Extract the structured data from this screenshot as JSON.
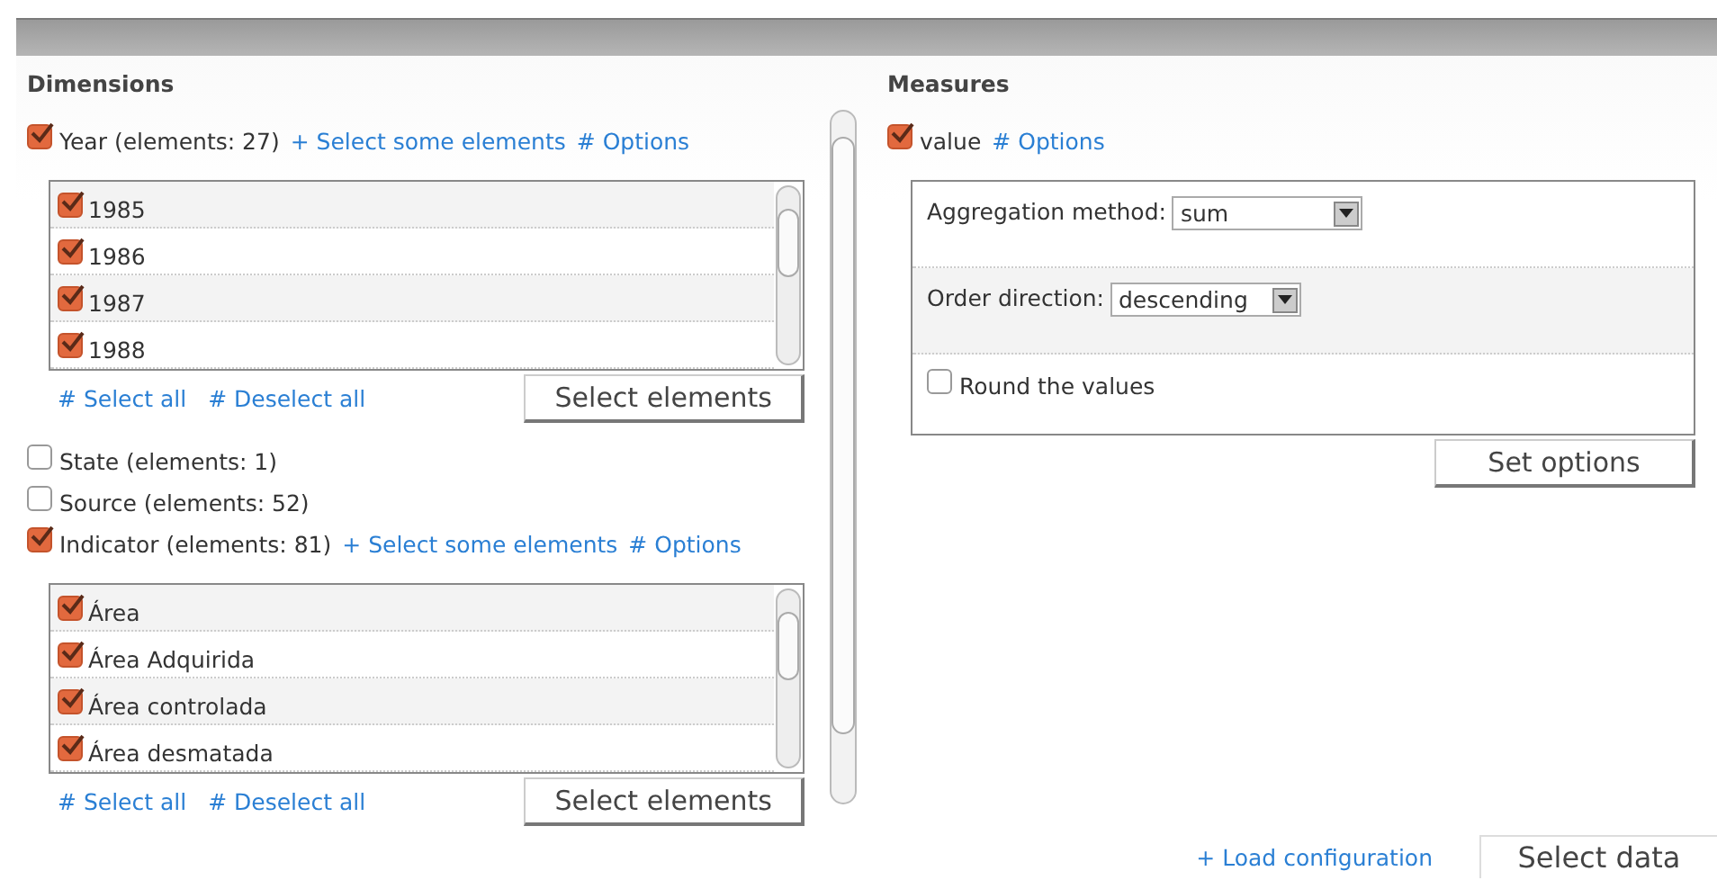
{
  "dimensions": {
    "title": "Dimensions",
    "items": [
      {
        "label": "Year (elements: 27)",
        "checked": true,
        "links": [
          "+ Select some elements",
          "# Options"
        ],
        "elements": {
          "items": [
            {
              "label": "1985",
              "checked": true
            },
            {
              "label": "1986",
              "checked": true
            },
            {
              "label": "1987",
              "checked": true
            },
            {
              "label": "1988",
              "checked": true
            }
          ],
          "select_all": "# Select all",
          "deselect_all": "# Deselect all",
          "button": "Select elements"
        }
      },
      {
        "label": "State (elements: 1)",
        "checked": false
      },
      {
        "label": "Source (elements: 52)",
        "checked": false
      },
      {
        "label": "Indicator (elements: 81)",
        "checked": true,
        "links": [
          "+ Select some elements",
          "# Options"
        ],
        "elements": {
          "items": [
            {
              "label": "Área",
              "checked": true
            },
            {
              "label": "Área Adquirida",
              "checked": true
            },
            {
              "label": "Área controlada",
              "checked": true
            },
            {
              "label": "Área desmatada",
              "checked": true
            }
          ],
          "select_all": "# Select all",
          "deselect_all": "# Deselect all",
          "button": "Select elements"
        }
      }
    ]
  },
  "measures": {
    "title": "Measures",
    "items": [
      {
        "label": "value",
        "checked": true,
        "link": "# Options",
        "options": {
          "fields": [
            {
              "kind": "select",
              "label": "Aggregation method:",
              "value": "sum"
            },
            {
              "kind": "select",
              "label": "Order direction:",
              "value": "descending"
            },
            {
              "kind": "checkbox",
              "label": "Round the values",
              "checked": false
            }
          ],
          "button": "Set options"
        }
      }
    ]
  },
  "footer": {
    "link": "+ Load configuration",
    "button": "Select data"
  }
}
